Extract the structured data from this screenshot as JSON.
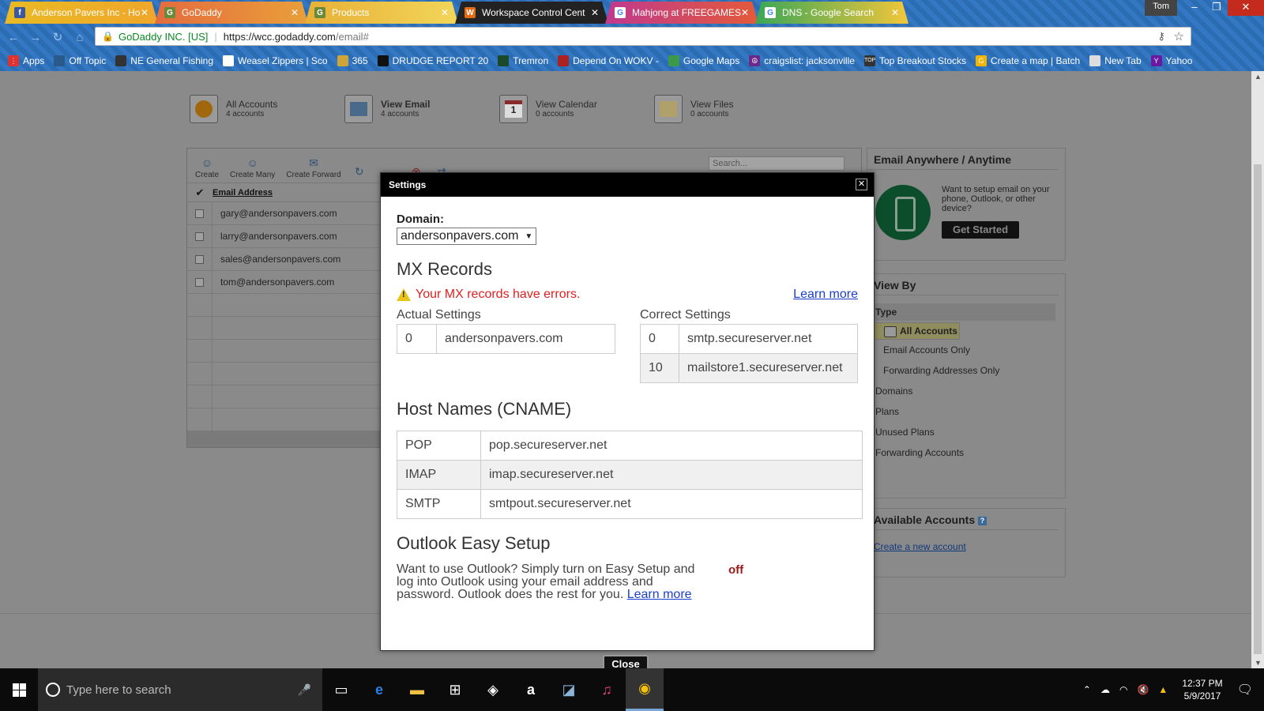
{
  "browser": {
    "tabs": [
      {
        "title": "Anderson Pavers Inc - Ho",
        "icon": "facebook-icon"
      },
      {
        "title": "GoDaddy",
        "icon": "godaddy-icon"
      },
      {
        "title": "Products",
        "icon": "godaddy-icon"
      },
      {
        "title": "Workspace Control Cent",
        "icon": "workspace-icon"
      },
      {
        "title": "Mahjong at FREEGAMES",
        "icon": "google-icon"
      },
      {
        "title": "DNS - Google Search",
        "icon": "google-icon"
      }
    ],
    "user": "Tom",
    "cert_label": "GoDaddy INC. [US]",
    "url_host": "https://wcc.godaddy.com",
    "url_path": "/email#",
    "bookmarks": [
      "Apps",
      "Off Topic",
      "NE General Fishing",
      "Weasel Zippers | Sco",
      "365",
      "DRUDGE REPORT 20",
      "Tremron",
      "Depend On WOKV -",
      "Google Maps",
      "craigslist: jacksonville",
      "Top Breakout Stocks",
      "Create a map | Batch",
      "New Tab",
      "Yahoo"
    ]
  },
  "topnav": [
    {
      "label": "All Accounts",
      "sub": "4 accounts"
    },
    {
      "label": "View Email",
      "sub": "4 accounts"
    },
    {
      "label": "View Calendar",
      "sub": "0 accounts"
    },
    {
      "label": "View Files",
      "sub": "0 accounts"
    }
  ],
  "toolbar": {
    "create": "Create",
    "create_many": "Create Many",
    "create_forward": "Create Forward",
    "search_placeholder": "Search..."
  },
  "grid": {
    "header": "Email Address",
    "rows": [
      "gary@andersonpavers.com",
      "larry@andersonpavers.com",
      "sales@andersonpavers.com",
      "tom@andersonpavers.com"
    ]
  },
  "sidebar": {
    "email_anywhere": {
      "title": "Email Anywhere / Anytime",
      "text": "Want to setup email on your phone, Outlook, or other device?",
      "button": "Get Started"
    },
    "view_by": {
      "title": "View By",
      "type_label": "Type",
      "types": [
        "All Accounts",
        "Email Accounts Only",
        "Forwarding Addresses Only"
      ],
      "others": [
        "Domains",
        "Plans",
        "Unused Plans",
        "Forwarding Accounts"
      ]
    },
    "available": {
      "title": "Available Accounts",
      "link": "Create a new account"
    }
  },
  "modal": {
    "title": "Settings",
    "domain_label": "Domain:",
    "domain_value": "andersonpavers.com",
    "mx_title": "MX Records",
    "mx_error": "Your MX records have errors.",
    "learn_more": "Learn more",
    "actual_label": "Actual Settings",
    "correct_label": "Correct Settings",
    "actual": [
      {
        "priority": "0",
        "host": "andersonpavers.com"
      }
    ],
    "correct": [
      {
        "priority": "0",
        "host": "smtp.secureserver.net"
      },
      {
        "priority": "10",
        "host": "mailstore1.secureserver.net"
      }
    ],
    "cname_title": "Host Names (CNAME)",
    "cname": [
      {
        "name": "POP",
        "value": "pop.secureserver.net"
      },
      {
        "name": "IMAP",
        "value": "imap.secureserver.net"
      },
      {
        "name": "SMTP",
        "value": "smtpout.secureserver.net"
      }
    ],
    "outlook_title": "Outlook Easy Setup",
    "outlook_text": "Want to use Outlook? Simply turn on Easy Setup and log into Outlook using your email address and password. Outlook does the rest for you.",
    "outlook_learn": "Learn more",
    "toggle_state": "off",
    "close": "Close"
  },
  "taskbar": {
    "search_placeholder": "Type here to search",
    "time": "12:37 PM",
    "date": "5/9/2017"
  }
}
